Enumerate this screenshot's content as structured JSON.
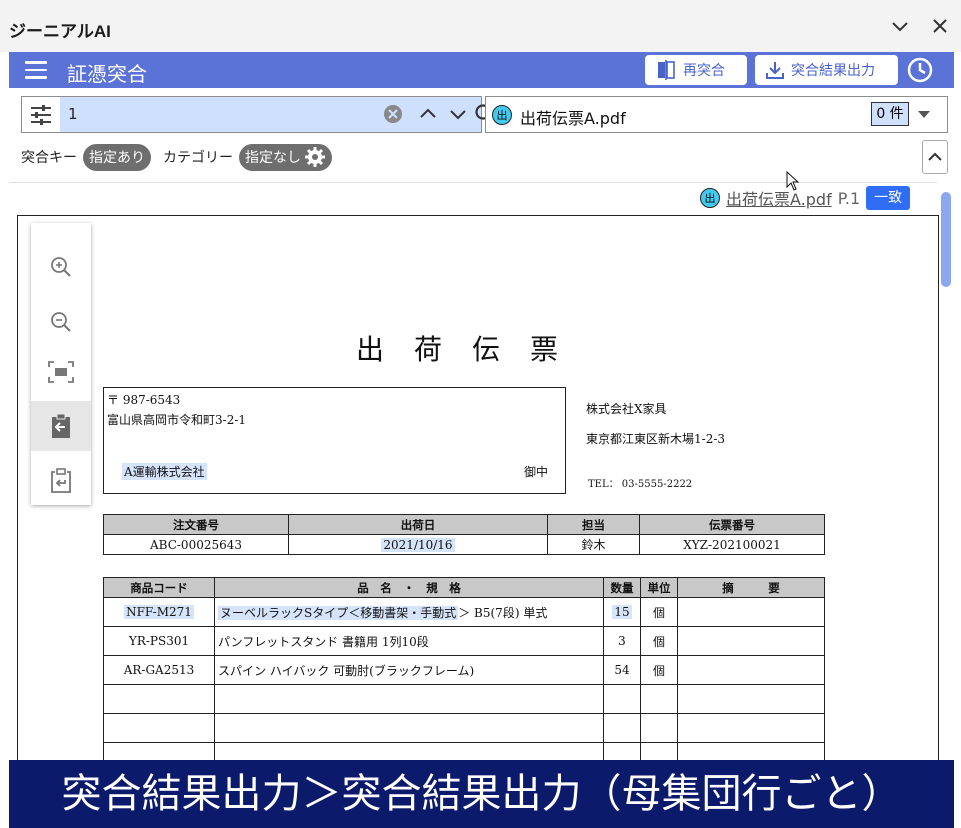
{
  "window": {
    "title": "ジーニアルAI"
  },
  "header": {
    "title": "証憑突合",
    "rematch_label": "再突合",
    "export_label": "突合結果出力"
  },
  "search": {
    "value": "1"
  },
  "file": {
    "chip": "出",
    "name": "出荷伝票A.pdf",
    "count": "0 件"
  },
  "filters": {
    "match_key_label": "突合キー",
    "match_key_value": "指定あり",
    "category_label": "カテゴリー",
    "category_value": "指定なし"
  },
  "viewer": {
    "chip": "出",
    "file_link": "出荷伝票A.pdf",
    "page": "P.1",
    "status": "一致"
  },
  "document": {
    "title": "出荷伝票",
    "recipient": {
      "postal": "〒 987-6543",
      "address": "富山県高岡市令和町3-2-1",
      "company": "A運輸株式会社",
      "honorific": "御中"
    },
    "sender": {
      "company": "株式会社X家具",
      "address": "東京都江東区新木場1-2-3",
      "tel": "TEL： 03-5555-2222"
    },
    "order_table": {
      "headers": [
        "注文番号",
        "出荷日",
        "担当",
        "伝票番号"
      ],
      "row": [
        "ABC-00025643",
        "2021/10/16",
        "鈴木",
        "XYZ-202100021"
      ]
    },
    "items_table": {
      "headers": [
        "商品コード",
        "品　名　・　規　格",
        "数量",
        "単位",
        "摘　　　要"
      ],
      "rows": [
        {
          "code": "NFF-M271",
          "name_hl": "ヌーベルラックSタイプ＜移動書架・手動式",
          "name_rest": "＞ B5(7段) 単式",
          "qty": "15",
          "unit": "個",
          "note": ""
        },
        {
          "code": "YR-PS301",
          "name_hl": "",
          "name_rest": "パンフレットスタンド 書籍用 1列10段",
          "qty": "3",
          "unit": "個",
          "note": ""
        },
        {
          "code": "AR-GA2513",
          "name_hl": "",
          "name_rest": "スパイン ハイバック 可動肘(ブラックフレーム)",
          "qty": "54",
          "unit": "個",
          "note": ""
        }
      ]
    }
  },
  "caption": "突合結果出力＞突合結果出力（母集団行ごと）",
  "colors": {
    "header_bg": "#5b73d6",
    "highlight": "#d6e4fb",
    "caption_bg": "#0c1a6b",
    "match_badge": "#2f6df6"
  }
}
